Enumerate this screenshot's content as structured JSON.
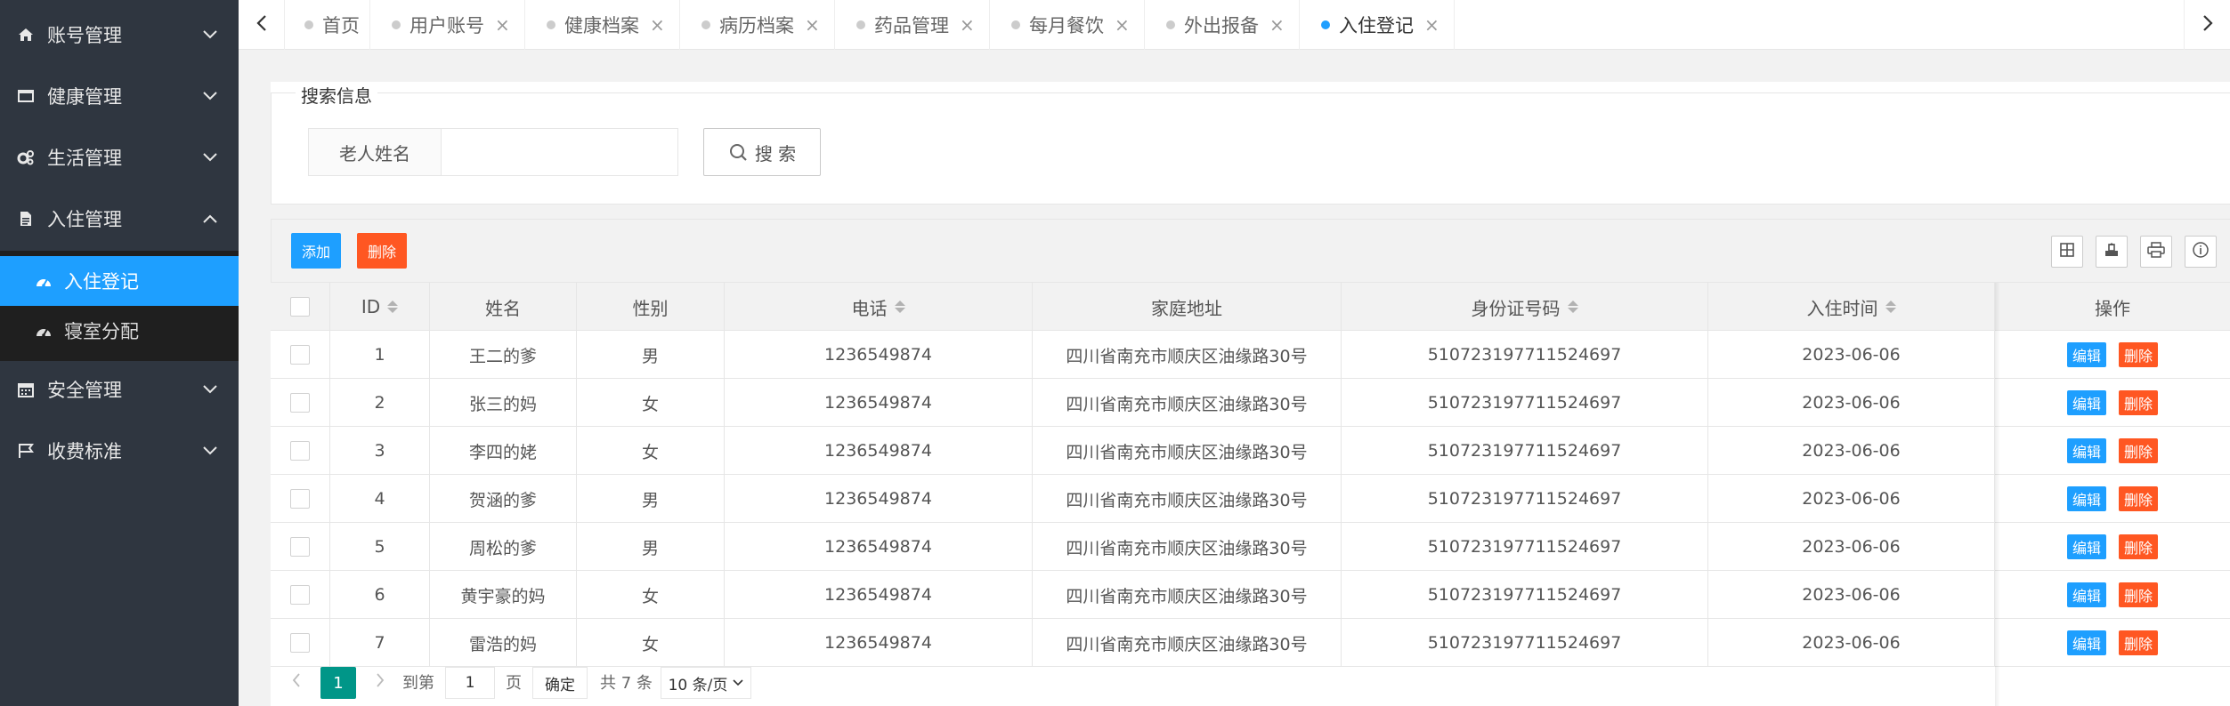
{
  "sidebar": {
    "items": [
      {
        "label": "账号管理",
        "icon": "home-icon"
      },
      {
        "label": "健康管理",
        "icon": "window-icon"
      },
      {
        "label": "生活管理",
        "icon": "gears-icon"
      },
      {
        "label": "入住管理",
        "icon": "file-icon",
        "expanded": true
      },
      {
        "label": "安全管理",
        "icon": "calendar-icon"
      },
      {
        "label": "收费标准",
        "icon": "flag-icon"
      }
    ],
    "sub_items": [
      {
        "label": "入住登记",
        "icon": "dashboard-icon",
        "active": true
      },
      {
        "label": "寝室分配",
        "icon": "dashboard-icon"
      }
    ]
  },
  "tabs": [
    {
      "label": "首页",
      "closable": false
    },
    {
      "label": "用户账号",
      "closable": true
    },
    {
      "label": "健康档案",
      "closable": true
    },
    {
      "label": "病历档案",
      "closable": true
    },
    {
      "label": "药品管理",
      "closable": true
    },
    {
      "label": "每月餐饮",
      "closable": true
    },
    {
      "label": "外出报备",
      "closable": true
    },
    {
      "label": "入住登记",
      "closable": true,
      "active": true
    }
  ],
  "tab_close_glyph": "×",
  "search": {
    "legend": "搜索信息",
    "field_label": "老人姓名",
    "field_value": "",
    "button_label": "搜 索"
  },
  "toolbar": {
    "add_label": "添加",
    "delete_label": "删除"
  },
  "table": {
    "columns": [
      "",
      "ID",
      "姓名",
      "性别",
      "电话",
      "家庭地址",
      "身份证号码",
      "入住时间",
      "操作"
    ],
    "rows": [
      [
        "1",
        "王二的爹",
        "男",
        "1236549874",
        "四川省南充市顺庆区油缘路30号",
        "510723197711524697",
        "2023-06-06"
      ],
      [
        "2",
        "张三的妈",
        "女",
        "1236549874",
        "四川省南充市顺庆区油缘路30号",
        "510723197711524697",
        "2023-06-06"
      ],
      [
        "3",
        "李四的姥",
        "女",
        "1236549874",
        "四川省南充市顺庆区油缘路30号",
        "510723197711524697",
        "2023-06-06"
      ],
      [
        "4",
        "贺涵的爹",
        "男",
        "1236549874",
        "四川省南充市顺庆区油缘路30号",
        "510723197711524697",
        "2023-06-06"
      ],
      [
        "5",
        "周松的爹",
        "男",
        "1236549874",
        "四川省南充市顺庆区油缘路30号",
        "510723197711524697",
        "2023-06-06"
      ],
      [
        "6",
        "黄宇豪的妈",
        "女",
        "1236549874",
        "四川省南充市顺庆区油缘路30号",
        "510723197711524697",
        "2023-06-06"
      ],
      [
        "7",
        "雷浩的妈",
        "女",
        "1236549874",
        "四川省南充市顺庆区油缘路30号",
        "510723197711524697",
        "2023-06-06"
      ]
    ],
    "edit_label": "编辑",
    "delete_label": "删除"
  },
  "pager": {
    "current_page": "1",
    "goto_label": "到第",
    "goto_value": "1",
    "page_unit": "页",
    "confirm_label": "确定",
    "total_label": "共 7 条",
    "page_size_label": "10 条/页"
  },
  "colors": {
    "sidebar_bg": "#2f3640",
    "active_blue": "#1e9fff",
    "danger_orange": "#ff5722",
    "pager_green": "#009688"
  }
}
